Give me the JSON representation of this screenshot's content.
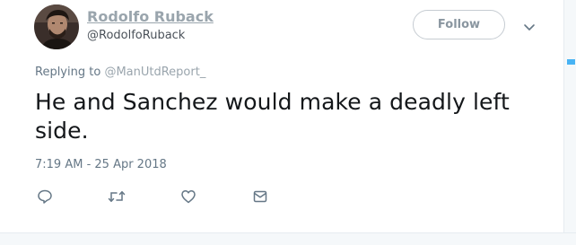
{
  "author": {
    "display_name": "Rodolfo Ruback",
    "handle": "@RodolfoRuback",
    "avatar_icon": "profile-photo"
  },
  "follow_button": {
    "label": "Follow"
  },
  "menu": {
    "icon": "chevron-down-icon"
  },
  "reply": {
    "prefix": "Replying to",
    "mention": "@ManUtdReport_"
  },
  "tweet": {
    "text": "He and Sanchez would make a deadly left side.",
    "timestamp": "7:19 AM - 25 Apr 2018"
  },
  "actions": [
    {
      "name": "reply",
      "icon": "reply-icon"
    },
    {
      "name": "retweet",
      "icon": "retweet-icon"
    },
    {
      "name": "like",
      "icon": "heart-icon"
    },
    {
      "name": "message",
      "icon": "envelope-icon"
    }
  ],
  "colors": {
    "text": "#14171a",
    "secondary": "#657786",
    "accent": "#1da1f2",
    "icon": "#657786"
  }
}
